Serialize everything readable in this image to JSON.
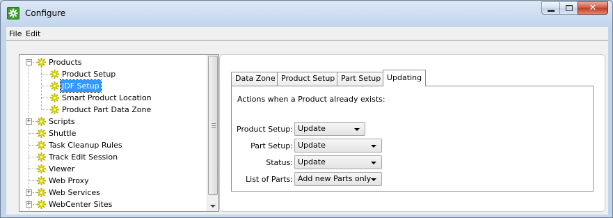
{
  "window": {
    "title": "Configure",
    "icon": "gear-icon",
    "controls": {
      "minimize": "minimize-icon",
      "maximize": "maximize-icon",
      "close": "close-icon"
    }
  },
  "menu": {
    "items": [
      "File",
      "Edit"
    ]
  },
  "tree": {
    "nodes": [
      {
        "label": "Products",
        "level": 0,
        "expander": "−"
      },
      {
        "label": "Product Setup",
        "level": 1
      },
      {
        "label": "JDF Setup",
        "level": 1,
        "selected": true
      },
      {
        "label": "Smart Product Location",
        "level": 1
      },
      {
        "label": "Product Part Data Zone",
        "level": 1
      },
      {
        "label": "Scripts",
        "level": 0,
        "expander": "+"
      },
      {
        "label": "Shuttle",
        "level": 0
      },
      {
        "label": "Task Cleanup Rules",
        "level": 0
      },
      {
        "label": "Track Edit Session",
        "level": 0
      },
      {
        "label": "Viewer",
        "level": 0
      },
      {
        "label": "Web Proxy",
        "level": 0
      },
      {
        "label": "Web Services",
        "level": 0,
        "expander": "+"
      },
      {
        "label": "WebCenter Sites",
        "level": 0,
        "expander": "+"
      }
    ]
  },
  "tabs": {
    "items": [
      "Data Zone",
      "Product Setup",
      "Part Setup",
      "Updating"
    ],
    "active": "Updating"
  },
  "updating": {
    "heading": "Actions when a Product already exists:",
    "fields": [
      {
        "label": "Product Setup:",
        "value": "Update"
      },
      {
        "label": "Part Setup:",
        "value": "Update"
      },
      {
        "label": "Status:",
        "value": "Update"
      },
      {
        "label": "List of Parts:",
        "value": "Add new Parts only"
      }
    ]
  }
}
